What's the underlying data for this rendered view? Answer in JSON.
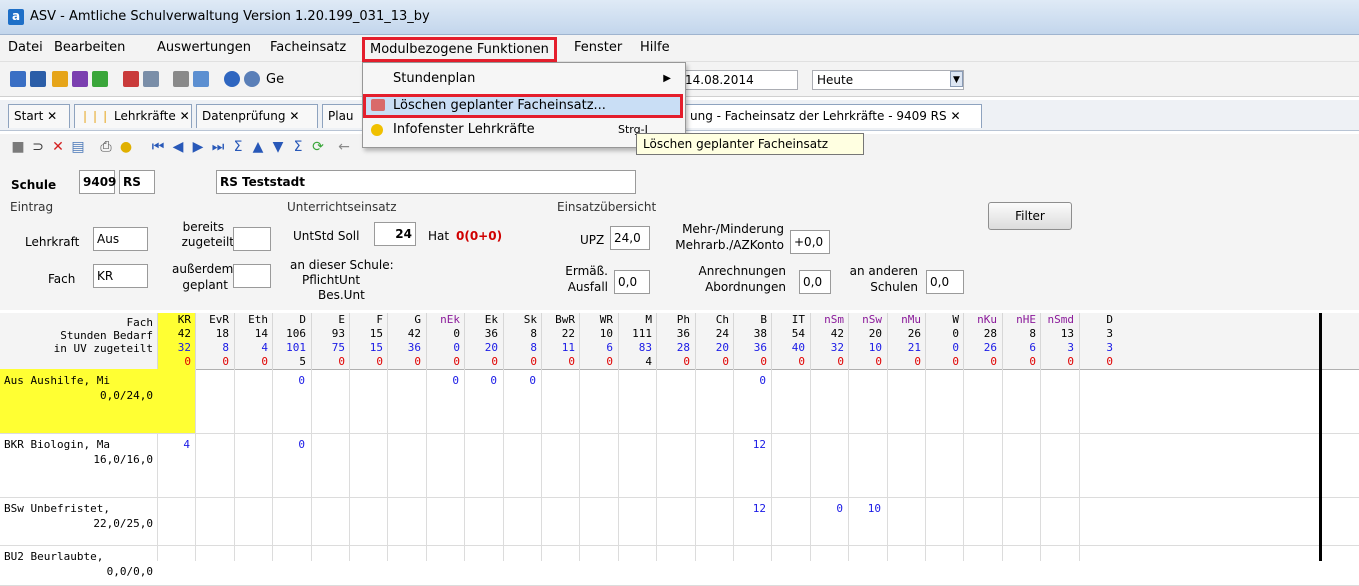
{
  "window": {
    "title": "ASV - Amtliche Schulverwaltung Version 1.20.199_031_13_by",
    "app_icon": "a"
  },
  "menu": [
    {
      "label": "Datei"
    },
    {
      "label": "Bearbeiten"
    },
    {
      "label": "Auswertungen"
    },
    {
      "label": "Facheinsatz"
    },
    {
      "label": "Modulbezogene Funktionen"
    },
    {
      "label": "Fenster"
    },
    {
      "label": "Hilfe"
    }
  ],
  "toolbar": {
    "ge_label": "Ge",
    "date_value": "14.08.2014",
    "heute_value": "Heute"
  },
  "dropdown": {
    "items": [
      {
        "label": "Stundenplan",
        "arrow": "▶"
      },
      {
        "label": "Löschen geplanter Facheinsatz..."
      },
      {
        "label": "Infofenster Lehrkräfte",
        "shortcut": "Strg-I"
      }
    ]
  },
  "tooltip": "Löschen geplanter Facheinsatz",
  "tabs": [
    {
      "label": "Start"
    },
    {
      "label": "Lehrkräfte"
    },
    {
      "label": "Datenprüfung"
    },
    {
      "label": "Plau"
    },
    {
      "label": "ung - Facheinsatz der Lehrkräfte - 9409 RS"
    }
  ],
  "tab_close": "✕",
  "school": {
    "label": "Schule",
    "number": "9409",
    "type": "RS",
    "name": "RS Teststadt"
  },
  "groups": {
    "eintrag": "Eintrag",
    "unterricht": "Unterrichtseinsatz",
    "uebersicht": "Einsatzübersicht"
  },
  "form": {
    "lehrkraft_label": "Lehrkraft",
    "lehrkraft_value": "Aus",
    "fach_label": "Fach",
    "fach_value": "KR",
    "bereits_line1": "bereits",
    "bereits_line2": "zugeteilt",
    "ausserdem_line1": "außerdem",
    "ausserdem_line2": "geplant",
    "untstd_label": "UntStd Soll",
    "untstd_value": "24",
    "hat_label": "Hat",
    "hat_value": "0(0+0)",
    "an_dieser": "an dieser Schule:",
    "pflicht": "PflichtUnt",
    "bes": "Bes.Unt",
    "upz_label": "UPZ",
    "upz_value": "24,0",
    "mehr_line1": "Mehr-/Minderung",
    "mehr_line2": "Mehrarb./AZKonto",
    "mehr_value": "+0,0",
    "ermaess_line1": "Ermäß.",
    "ermaess_line2": "Ausfall",
    "ermaess_value": "0,0",
    "anrech_line1": "Anrechnungen",
    "anrech_line2": "Abordnungen",
    "anrech_value": "0,0",
    "anderen_line1": "an anderen",
    "anderen_line2": "Schulen",
    "anderen_value": "0,0",
    "filter_label": "Filter"
  },
  "grid": {
    "row_header_lines": [
      "Fach",
      "Stunden Bedarf",
      "in UV zugeteilt"
    ],
    "columns": [
      {
        "fach": "KR",
        "bedarf": "42",
        "zugeteilt": "32",
        "diff": "0",
        "highlight": true
      },
      {
        "fach": "EvR",
        "bedarf": "18",
        "zugeteilt": "8",
        "diff": "0"
      },
      {
        "fach": "Eth",
        "bedarf": "14",
        "zugeteilt": "4",
        "diff": "0"
      },
      {
        "fach": "D",
        "bedarf": "106",
        "zugeteilt": "101",
        "diff": "5"
      },
      {
        "fach": "E",
        "bedarf": "93",
        "zugeteilt": "75",
        "diff": "0"
      },
      {
        "fach": "F",
        "bedarf": "15",
        "zugeteilt": "15",
        "diff": "0"
      },
      {
        "fach": "G",
        "bedarf": "42",
        "zugeteilt": "36",
        "diff": "0"
      },
      {
        "fach": "nEk",
        "bedarf": "0",
        "zugeteilt": "0",
        "diff": "0"
      },
      {
        "fach": "Ek",
        "bedarf": "36",
        "zugeteilt": "20",
        "diff": "0"
      },
      {
        "fach": "Sk",
        "bedarf": "8",
        "zugeteilt": "8",
        "diff": "0"
      },
      {
        "fach": "BwR",
        "bedarf": "22",
        "zugeteilt": "11",
        "diff": "0"
      },
      {
        "fach": "WR",
        "bedarf": "10",
        "zugeteilt": "6",
        "diff": "0"
      },
      {
        "fach": "M",
        "bedarf": "111",
        "zugeteilt": "83",
        "diff": "4"
      },
      {
        "fach": "Ph",
        "bedarf": "36",
        "zugeteilt": "28",
        "diff": "0"
      },
      {
        "fach": "Ch",
        "bedarf": "24",
        "zugeteilt": "20",
        "diff": "0"
      },
      {
        "fach": "B",
        "bedarf": "38",
        "zugeteilt": "36",
        "diff": "0"
      },
      {
        "fach": "IT",
        "bedarf": "54",
        "zugeteilt": "40",
        "diff": "0"
      },
      {
        "fach": "nSm",
        "bedarf": "42",
        "zugeteilt": "32",
        "diff": "0"
      },
      {
        "fach": "nSw",
        "bedarf": "20",
        "zugeteilt": "10",
        "diff": "0"
      },
      {
        "fach": "nMu",
        "bedarf": "26",
        "zugeteilt": "21",
        "diff": "0"
      },
      {
        "fach": "W",
        "bedarf": "0",
        "zugeteilt": "0",
        "diff": "0"
      },
      {
        "fach": "nKu",
        "bedarf": "28",
        "zugeteilt": "26",
        "diff": "0"
      },
      {
        "fach": "nHE",
        "bedarf": "8",
        "zugeteilt": "6",
        "diff": "0"
      },
      {
        "fach": "nSmd",
        "bedarf": "13",
        "zugeteilt": "3",
        "diff": "0"
      },
      {
        "fach": "D",
        "bedarf": "3",
        "zugeteilt": "3",
        "diff": "0"
      }
    ],
    "rows": [
      {
        "line1": "Aus Aushilfe, Mi",
        "line2": "0,0/24,0",
        "highlight": true,
        "values": {
          "3": "0",
          "7": "0",
          "8": "0",
          "9": "0",
          "15": "0"
        }
      },
      {
        "line1": "BKR Biologin, Ma",
        "line2": "16,0/16,0",
        "values": {
          "0": "4",
          "3": "0",
          "15": "12"
        }
      },
      {
        "line1": "BSw Unbefristet,",
        "line2": "22,0/25,0",
        "values": {
          "15": "12",
          "17": "0",
          "18": "10"
        }
      },
      {
        "line1": "BU2 Beurlaubte,",
        "line2": "0,0/0,0",
        "values": {}
      }
    ]
  }
}
